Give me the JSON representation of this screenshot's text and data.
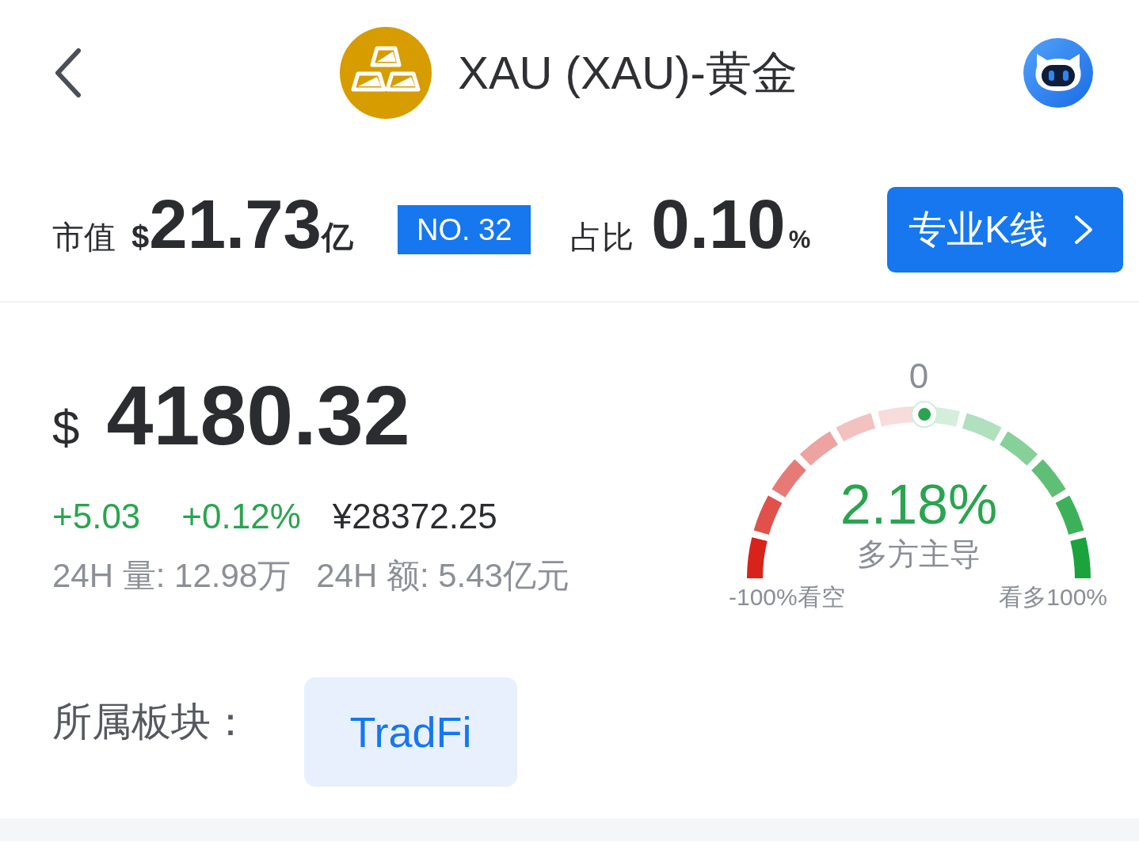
{
  "header": {
    "title": "XAU (XAU)-黄金"
  },
  "summary": {
    "market_cap_label": "市值",
    "market_cap_currency": "$",
    "market_cap_value": "21.73",
    "market_cap_unit": "亿",
    "rank": "NO. 32",
    "share_label": "占比",
    "share_value": "0.10",
    "share_unit": "%",
    "kline_button": "专业K线"
  },
  "price": {
    "currency": "$",
    "value": "4180.32",
    "rising": true,
    "change": "+5.03",
    "change_percent": "+0.12%",
    "cny_price": "¥28372.25",
    "volume_24h": "24H 量: 12.98万",
    "turnover_24h": "24H 额: 5.43亿元"
  },
  "sentiment_gauge": {
    "center_label": "0",
    "level": 0.511,
    "value": "2.18%",
    "verdict": "多方主导",
    "min_label": "-100%看空",
    "max_label": "看多100%"
  },
  "sector": {
    "label": "所属板块：",
    "tags": [
      "TradFi"
    ]
  }
}
